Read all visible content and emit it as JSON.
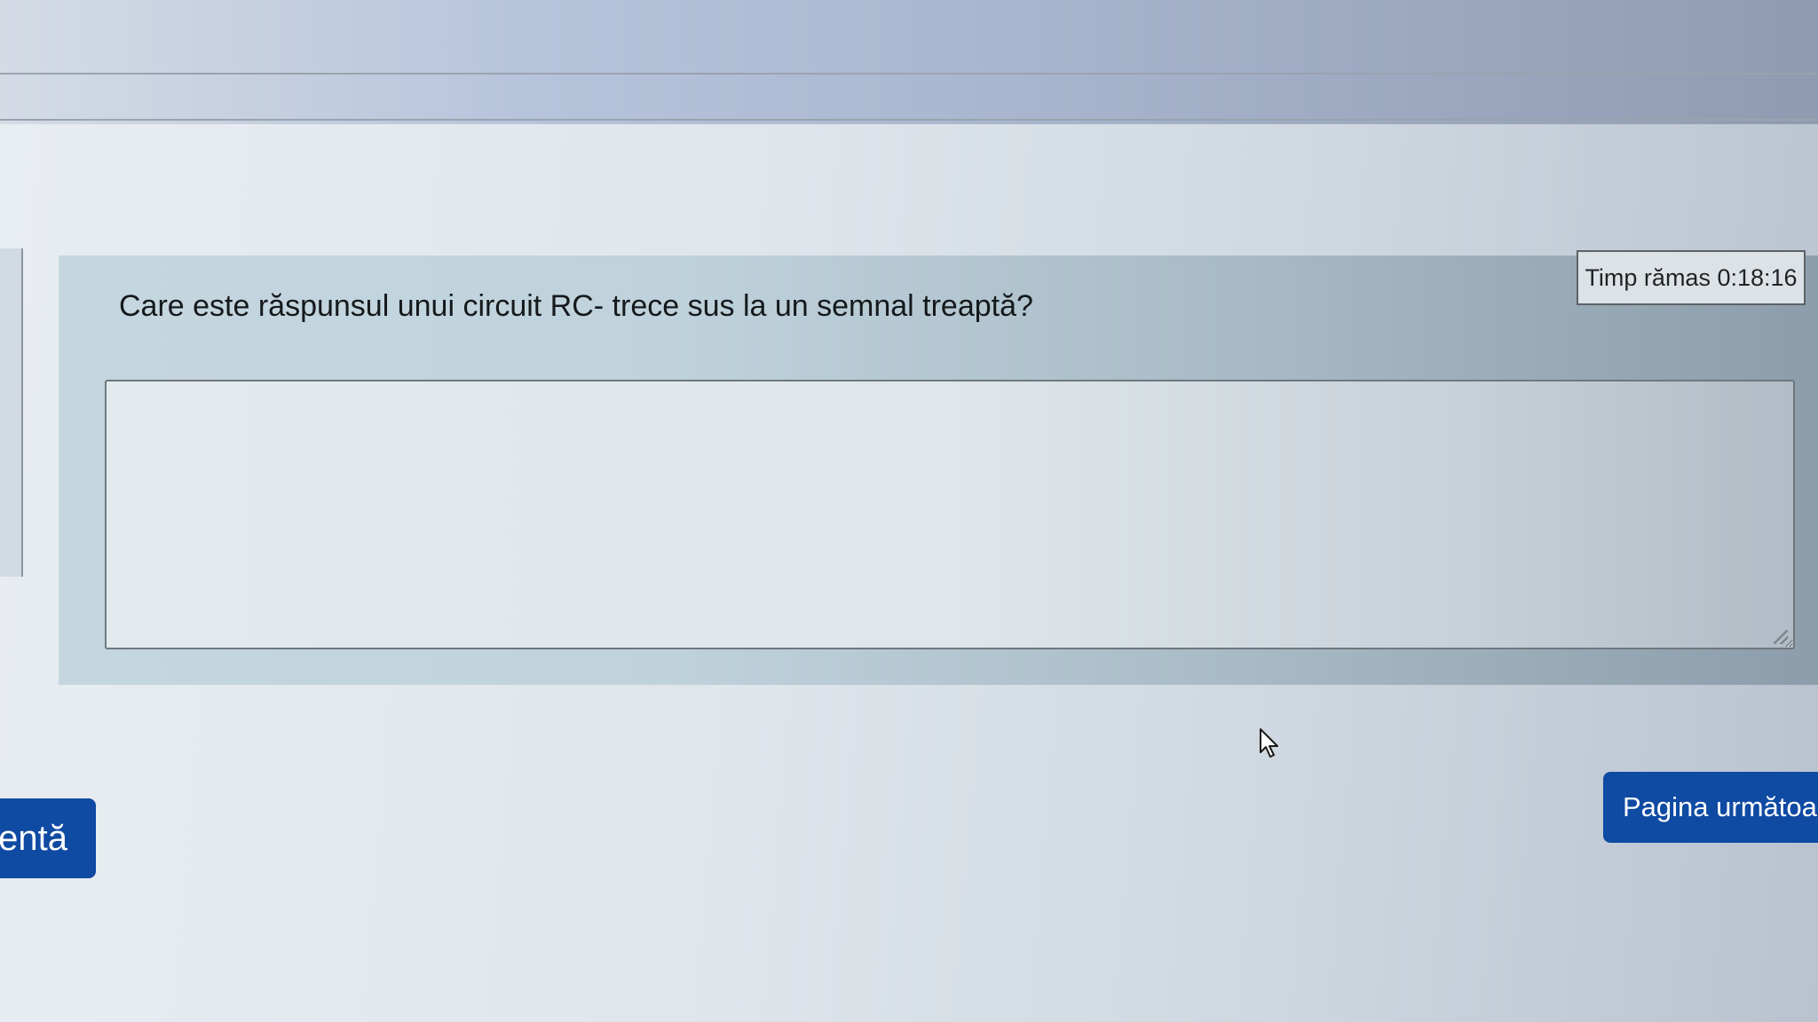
{
  "timer": {
    "label": "Timp rămas 0:18:16"
  },
  "question": {
    "text": "Care este răspunsul unui circuit RC- trece sus la un semnal treaptă?"
  },
  "answer": {
    "value": "",
    "placeholder": ""
  },
  "navigation": {
    "previous_label_visible": "entă",
    "next_label": "Pagina următoare"
  },
  "colors": {
    "button_bg": "#0f4aa3",
    "button_text": "#ffffff",
    "question_card_bg": "#c5d6df"
  },
  "icons": {
    "cursor": "mouse-pointer-icon",
    "resize": "resize-grip-icon"
  }
}
